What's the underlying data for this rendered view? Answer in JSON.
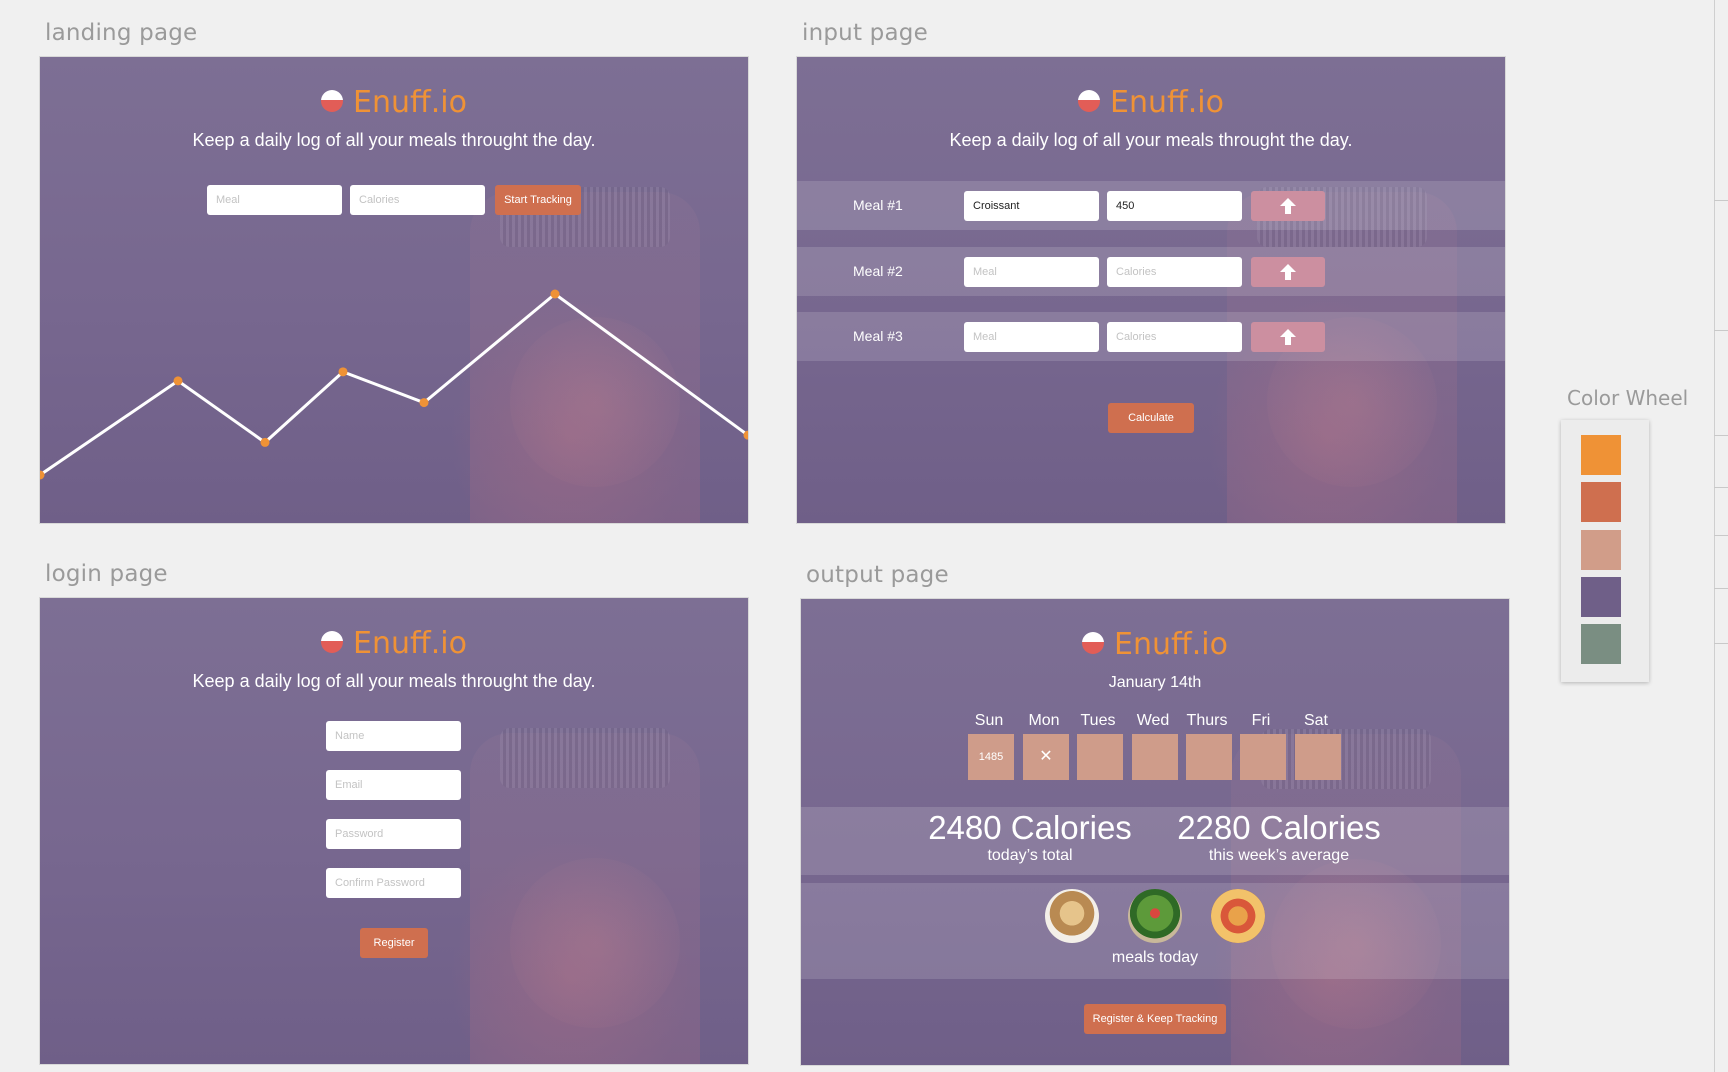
{
  "sections": {
    "landing": "landing page",
    "input": "input page",
    "login": "login page",
    "output": "output page"
  },
  "brand": {
    "name": "Enuff.io",
    "tagline": "Keep a daily log of all your meals throught the day."
  },
  "landing": {
    "meal_placeholder": "Meal",
    "calories_placeholder": "Calories",
    "start_button": "Start Tracking",
    "trend_line_relative_values": [
      0.0,
      0.52,
      0.18,
      0.57,
      0.4,
      1.0,
      0.22
    ]
  },
  "input": {
    "meals": [
      {
        "label": "Meal #1",
        "meal": "Croissant",
        "calories": "450"
      },
      {
        "label": "Meal #2",
        "meal": "",
        "calories": ""
      },
      {
        "label": "Meal #3",
        "meal": "",
        "calories": ""
      }
    ],
    "meal_placeholder": "Meal",
    "calories_placeholder": "Calories",
    "calculate_button": "Calculate"
  },
  "login": {
    "name_placeholder": "Name",
    "email_placeholder": "Email",
    "password_placeholder": "Password",
    "confirm_placeholder": "Confirm Password",
    "register_button": "Register"
  },
  "output": {
    "date": "January 14th",
    "days": [
      {
        "label": "Sun",
        "value": "1485"
      },
      {
        "label": "Mon",
        "value": "✕"
      },
      {
        "label": "Tues",
        "value": ""
      },
      {
        "label": "Wed",
        "value": ""
      },
      {
        "label": "Thurs",
        "value": ""
      },
      {
        "label": "Fri",
        "value": ""
      },
      {
        "label": "Sat",
        "value": ""
      }
    ],
    "today_total": "2480 Calories",
    "today_total_label": "today’s total",
    "week_average": "2280 Calories",
    "week_average_label": "this week’s average",
    "meals_label": "meals today",
    "register_button": "Register & Keep Tracking"
  },
  "color_wheel": {
    "title": "Color Wheel",
    "colors": [
      "#ef9236",
      "#cf6f4f",
      "#d19d89",
      "#6f5f88",
      "#7a8e82"
    ]
  }
}
